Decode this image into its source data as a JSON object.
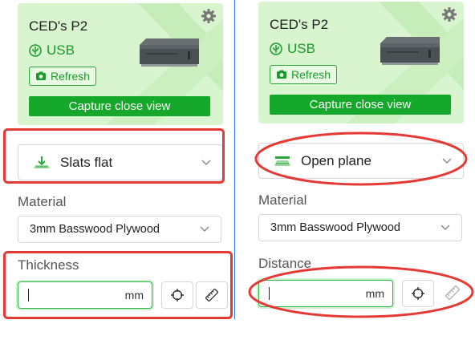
{
  "panels": [
    {
      "device_name": "CED's P2",
      "connection": "USB",
      "refresh_label": "Refresh",
      "capture_label": "Capture close view",
      "mode_label": "Slats flat",
      "material_label": "Material",
      "material_value": "3mm Basswood Plywood",
      "measure_label": "Thickness",
      "unit": "mm",
      "mode_icon": "slats-flat-icon"
    },
    {
      "device_name": "CED's P2",
      "connection": "USB",
      "refresh_label": "Refresh",
      "capture_label": "Capture close view",
      "mode_label": "Open plane",
      "material_label": "Material",
      "material_value": "3mm Basswood Plywood",
      "measure_label": "Distance",
      "unit": "mm",
      "mode_icon": "open-plane-icon"
    }
  ],
  "colors": {
    "accent": "#16a82b",
    "card_bg": "#d9f5cf",
    "annotation": "#e53935",
    "divider": "#2b78e4"
  }
}
